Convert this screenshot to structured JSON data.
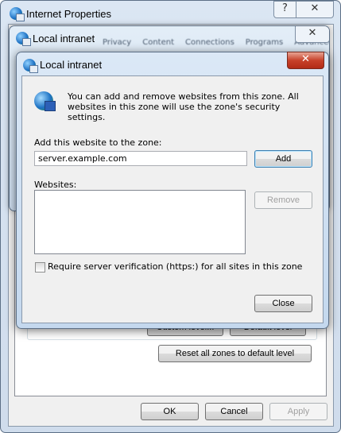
{
  "outer": {
    "title": "Internet Properties",
    "help": "?",
    "close": "✕",
    "tabs": [
      "Privacy",
      "Content",
      "Connections",
      "Programs",
      "Advanced"
    ],
    "custom_level": "Custom level...",
    "default_level": "Default level",
    "reset_all": "Reset all zones to default level",
    "ok": "OK",
    "cancel": "Cancel",
    "apply": "Apply"
  },
  "middle": {
    "title": "Local intranet",
    "close": "✕"
  },
  "dialog": {
    "title": "Local intranet",
    "close": "✕",
    "description": "You can add and remove websites from this zone. All websites in this zone will use the zone's security settings.",
    "add_label": "Add this website to the zone:",
    "add_value": "server.example.com",
    "add_button": "Add",
    "websites_label": "Websites:",
    "websites": [],
    "remove_button": "Remove",
    "require_https_label": "Require server verification (https:) for all sites in this zone",
    "require_https_checked": false,
    "close_button": "Close"
  }
}
